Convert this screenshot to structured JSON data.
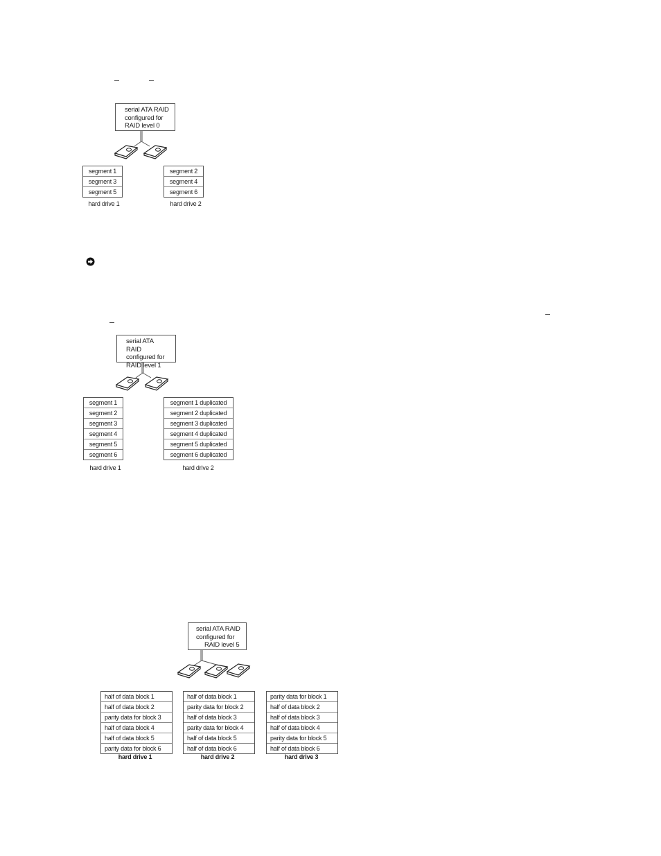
{
  "notice_icon": "notice-icon",
  "raid0": {
    "config_box": [
      "serial ATA RAID",
      "configured for",
      "RAID level 0"
    ],
    "drives": [
      {
        "label": "hard drive 1",
        "rows": [
          "segment 1",
          "segment 3",
          "segment 5"
        ]
      },
      {
        "label": "hard drive 2",
        "rows": [
          "segment 2",
          "segment 4",
          "segment 6"
        ]
      }
    ]
  },
  "raid1": {
    "config_box": [
      "serial ATA RAID",
      "configured for",
      "RAID level 1"
    ],
    "drives": [
      {
        "label": "hard drive 1",
        "rows": [
          "segment 1",
          "segment 2",
          "segment 3",
          "segment 4",
          "segment 5",
          "segment 6"
        ]
      },
      {
        "label": "hard drive 2",
        "rows": [
          "segment 1 duplicated",
          "segment 2 duplicated",
          "segment 3 duplicated",
          "segment 4 duplicated",
          "segment 5 duplicated",
          "segment 6 duplicated"
        ]
      }
    ]
  },
  "raid5": {
    "config_box": [
      "serial ATA RAID",
      "configured for",
      "RAID level 5"
    ],
    "drives": [
      {
        "label": "hard drive 1",
        "rows": [
          "half of data block 1",
          "half of data block 2",
          "parity data for block 3",
          "half of data block 4",
          "half of data block 5",
          "parity data for block 6"
        ]
      },
      {
        "label": "hard drive 2",
        "rows": [
          "half of data block 1",
          "parity data for block 2",
          "half of data block 3",
          "parity data for block 4",
          "half of data block 5",
          "half of data block 6"
        ]
      },
      {
        "label": "hard drive 3",
        "rows": [
          "parity data for block 1",
          "half of data block 2",
          "half of data block 3",
          "half of data block 4",
          "parity data for block 5",
          "half of data block 6"
        ]
      }
    ]
  }
}
